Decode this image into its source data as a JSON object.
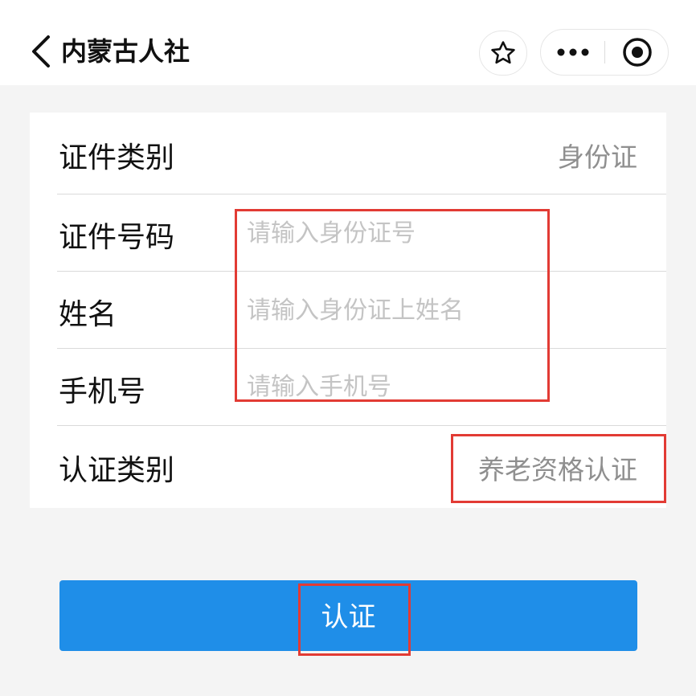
{
  "nav": {
    "title": "内蒙古人社",
    "back_icon": "chevron-left-icon",
    "star_icon": "star-outline-icon",
    "more_icon": "more-dots-icon",
    "close_icon": "target-circle-icon"
  },
  "form": {
    "id_type": {
      "label": "证件类别",
      "value": "身份证"
    },
    "id_number": {
      "label": "证件号码",
      "placeholder": "请输入身份证号",
      "value": ""
    },
    "name": {
      "label": "姓名",
      "placeholder": "请输入身份证上姓名",
      "value": ""
    },
    "phone": {
      "label": "手机号",
      "placeholder": "请输入手机号",
      "value": ""
    },
    "auth_type": {
      "label": "认证类别",
      "value": "养老资格认证"
    }
  },
  "submit": {
    "label": "认证"
  },
  "colors": {
    "accent": "#1f8ee8",
    "highlight": "#e23b34",
    "background": "#f4f4f4"
  }
}
